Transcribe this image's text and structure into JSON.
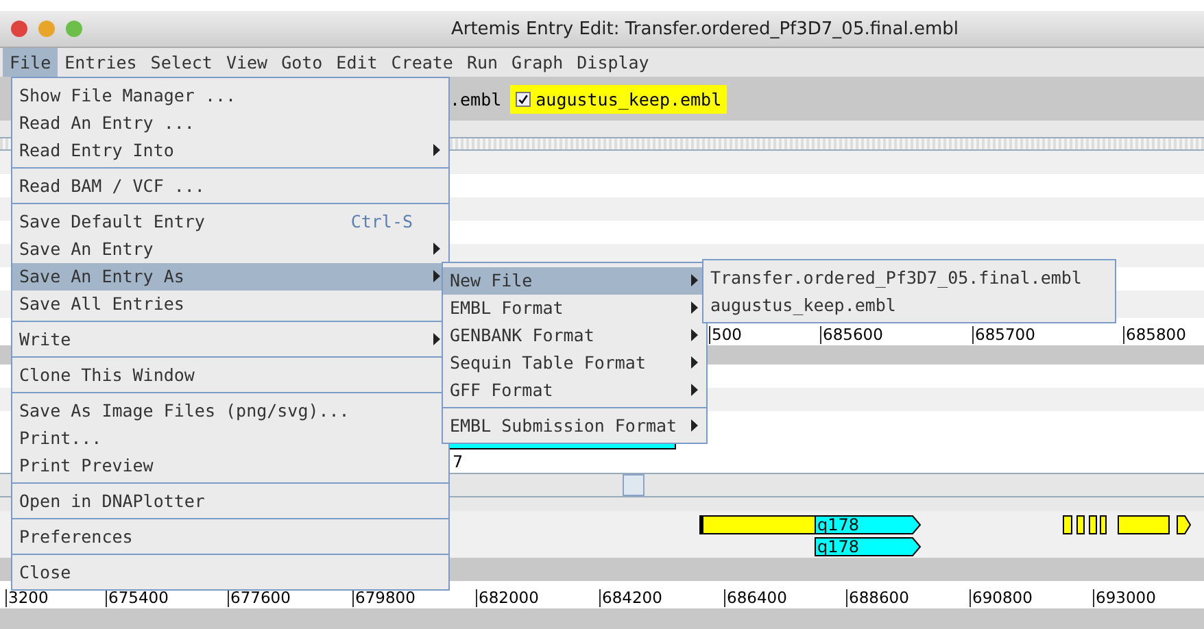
{
  "window": {
    "title": "Artemis Entry Edit: Transfer.ordered_Pf3D7_05.final.embl"
  },
  "menubar": [
    {
      "label": "File",
      "selected": true
    },
    {
      "label": "Entries",
      "selected": false
    },
    {
      "label": "Select",
      "selected": false
    },
    {
      "label": "View",
      "selected": false
    },
    {
      "label": "Goto",
      "selected": false
    },
    {
      "label": "Edit",
      "selected": false
    },
    {
      "label": "Create",
      "selected": false
    },
    {
      "label": "Run",
      "selected": false
    },
    {
      "label": "Graph",
      "selected": false
    },
    {
      "label": "Display",
      "selected": false
    }
  ],
  "entry_bar": {
    "label_fragment": ".embl",
    "entry": {
      "label": "augustus_keep.embl",
      "checked": true
    }
  },
  "top_ruler": [
    "500",
    "685600",
    "685700",
    "685800"
  ],
  "sequence_label": "7",
  "features": [
    {
      "label": "q178"
    },
    {
      "label": "q178"
    }
  ],
  "bottom_ruler": [
    "3200",
    "675400",
    "677600",
    "679800",
    "682000",
    "684200",
    "686400",
    "688600",
    "690800",
    "693000"
  ],
  "file_menu": [
    [
      {
        "label": "Show File Manager ...",
        "submenu": false,
        "selected": false
      },
      {
        "label": "Read An Entry ...",
        "submenu": false,
        "selected": false
      },
      {
        "label": "Read Entry Into",
        "submenu": true,
        "selected": false
      }
    ],
    [
      {
        "label": "Read BAM / VCF ...",
        "submenu": false,
        "selected": false
      }
    ],
    [
      {
        "label": "Save Default Entry",
        "shortcut": "Ctrl-S",
        "submenu": false,
        "selected": false
      },
      {
        "label": "Save An Entry",
        "submenu": true,
        "selected": false
      },
      {
        "label": "Save An Entry As",
        "submenu": true,
        "selected": true
      },
      {
        "label": "Save All Entries",
        "submenu": false,
        "selected": false
      }
    ],
    [
      {
        "label": "Write",
        "submenu": true,
        "selected": false
      }
    ],
    [
      {
        "label": "Clone This Window",
        "submenu": false,
        "selected": false
      }
    ],
    [
      {
        "label": "Save As Image Files (png/svg)...",
        "submenu": false,
        "selected": false
      },
      {
        "label": "Print...",
        "submenu": false,
        "selected": false
      },
      {
        "label": "Print Preview",
        "submenu": false,
        "selected": false
      }
    ],
    [
      {
        "label": "Open in DNAPlotter",
        "submenu": false,
        "selected": false
      }
    ],
    [
      {
        "label": "Preferences",
        "submenu": false,
        "selected": false
      }
    ],
    [
      {
        "label": "Close",
        "submenu": false,
        "selected": false
      }
    ]
  ],
  "save_as_menu": [
    [
      {
        "label": "New File",
        "submenu": true,
        "selected": true
      },
      {
        "label": "EMBL Format",
        "submenu": true,
        "selected": false
      },
      {
        "label": "GENBANK Format",
        "submenu": true,
        "selected": false
      },
      {
        "label": "Sequin Table Format",
        "submenu": true,
        "selected": false
      },
      {
        "label": "GFF Format",
        "submenu": true,
        "selected": false
      }
    ],
    [
      {
        "label": "EMBL Submission Format",
        "submenu": true,
        "selected": false
      }
    ]
  ],
  "new_file_menu": [
    [
      {
        "label": "Transfer.ordered_Pf3D7_05.final.embl",
        "submenu": false,
        "selected": false
      },
      {
        "label": "augustus_keep.embl",
        "submenu": false,
        "selected": false
      }
    ]
  ]
}
